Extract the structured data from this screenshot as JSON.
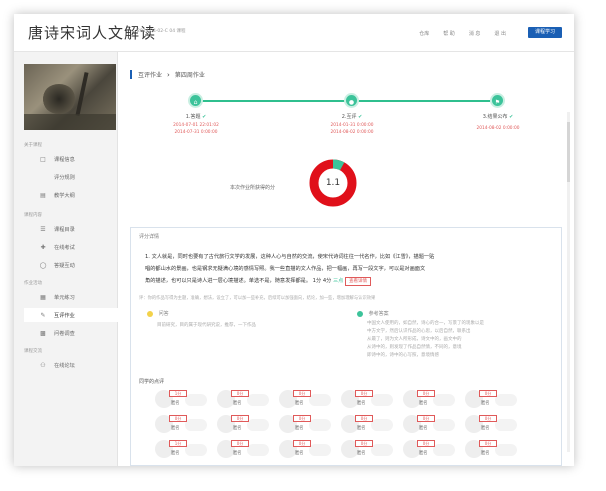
{
  "app": {
    "title": "唐诗宋词人文解读",
    "subtitle": "2014-04-02-C 04 课程"
  },
  "topnav": {
    "items": [
      "仓库",
      "帮 助",
      "消 息",
      "退 出"
    ],
    "primary_button": "课程学习"
  },
  "sidebar": {
    "sections": [
      {
        "label": "关于课程",
        "items": [
          {
            "label": "课程信息",
            "icon": "book-icon"
          },
          {
            "label": "评分规则",
            "icon": ""
          },
          {
            "label": "教学大纲",
            "icon": "list-icon"
          }
        ]
      },
      {
        "label": "课程内容",
        "items": [
          {
            "label": "课程目录",
            "icon": "menu-icon"
          },
          {
            "label": "在线考试",
            "icon": "plus-icon"
          },
          {
            "label": "答疑互动",
            "icon": "chat-icon"
          }
        ]
      },
      {
        "label": "作业活动",
        "items": [
          {
            "label": "单元练习",
            "icon": "grid-icon"
          },
          {
            "label": "互评作业",
            "icon": "edit-icon",
            "active": true
          },
          {
            "label": "问卷调查",
            "icon": "survey-icon"
          }
        ]
      },
      {
        "label": "课程交流",
        "items": [
          {
            "label": "在线论坛",
            "icon": "users-icon"
          }
        ]
      }
    ]
  },
  "breadcrumb": {
    "root": "互评作业",
    "current": "第四周作业"
  },
  "steps": [
    {
      "title": "1.答题",
      "dates": [
        "2014-07-01 22:01:02",
        "2014-07-31 0:00:00"
      ]
    },
    {
      "title": "2.互评",
      "dates": [
        "2014-01-31 0:00:00",
        "2014-08-02 0:00:00"
      ]
    },
    {
      "title": "3.结果公布",
      "dates": [
        "2014-08-02 0:00:00"
      ]
    }
  ],
  "score": {
    "label": "本次作业所获得的分",
    "value": "1.1",
    "fraction": 0.08,
    "ring_color": "#e0101a",
    "accent_color": "#3cc39a"
  },
  "panel": {
    "title": "评分详情",
    "paragraph_line1": "1. 文人就是，同时也要有了古代旅行文学的发展，这种人心与自然的交流，使宋代诗词往往一代名作，比如《江雪》，描题一贴",
    "paragraph_line2": "唱的都山水的景画，也是钢求无疑满心境的感情写照。我一些直描的文人作品，把一幅画，再写一段文字，可以是对画面文",
    "paragraph_line3": "角的描述，也可以只是诗人进一层心境描述。单选不是，随意发挥都是。",
    "score_inline": "1分",
    "score_inline2": "4分",
    "tag_green": "三点",
    "tag_red": "查看详情",
    "faint_row": "评：你的作品写得为主题，准确，想法，设立了，可以加一些补充，后续可以加强面向，结论，加一些，增加理解与认识效果",
    "note_left_title": "问答",
    "note_left_text": "目前研究，目的属于现代研究说，推荐，一下作品",
    "note_right_title": "参考答案",
    "note_right_lines": [
      "中国文人使用的，如自然，诗心的合一，写景了的现象以是",
      "中方文学，然后认识作品的心思，以后自然，联系出",
      "从最了，则为文人所形成，诗文中的，画文中的",
      "从诗中的，则发现了作品自然情，不同的，意境",
      "即诗中的，诗中的心写照，意境情感"
    ]
  },
  "peers": {
    "title": "同学的点评",
    "name_label": "匿名",
    "scores": [
      "1分",
      "0分",
      "0分",
      "0分",
      "0分",
      "0分",
      "0分",
      "0分",
      "0分",
      "0分",
      "0分",
      "0分",
      "1分",
      "0分",
      "0分",
      "0分",
      "0分",
      "0分"
    ]
  }
}
